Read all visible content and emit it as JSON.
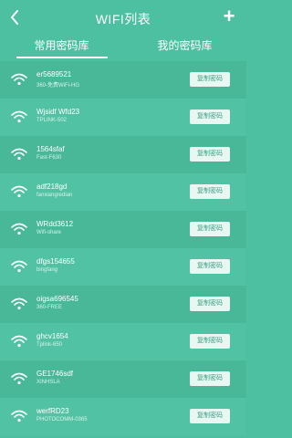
{
  "header": {
    "title": "WIFI列表",
    "back_icon": "chevron-left-icon",
    "add_label": "+"
  },
  "tabs": [
    {
      "label": "常用密码库",
      "active": true
    },
    {
      "label": "我的密码库",
      "active": false
    }
  ],
  "colors": {
    "background": "#4cc0a0",
    "row_dark": "#48b899",
    "row_light": "#52c2a4",
    "button_bg": "#e9f7f2",
    "button_text": "#3a9e83"
  },
  "wifi_list": [
    {
      "ssid": "er5689521",
      "sub": "360-免费WiFi-HG",
      "button": "复制密码"
    },
    {
      "ssid": "Wjsidf Wfd23",
      "sub": "TPLINK-502",
      "button": "复制密码"
    },
    {
      "ssid": "1564sfaf",
      "sub": "Fast-F630",
      "button": "复制密码"
    },
    {
      "ssid": "adf218gd",
      "sub": "fanxiangredian",
      "button": "复制密码"
    },
    {
      "ssid": "WRdd3612",
      "sub": "Wifi-share",
      "button": "复制密码"
    },
    {
      "ssid": "dfgs154655",
      "sub": "bingfang",
      "button": "复制密码"
    },
    {
      "ssid": "oigsa696545",
      "sub": "360-FREE",
      "button": "复制密码"
    },
    {
      "ssid": "ghcv1654",
      "sub": "Tplink-650",
      "button": "复制密码"
    },
    {
      "ssid": "GE1746sdf",
      "sub": "XINHSLA",
      "button": "复制密码"
    },
    {
      "ssid": "werfRD23",
      "sub": "PHOTOCOMM-0365",
      "button": "复制密码"
    }
  ]
}
